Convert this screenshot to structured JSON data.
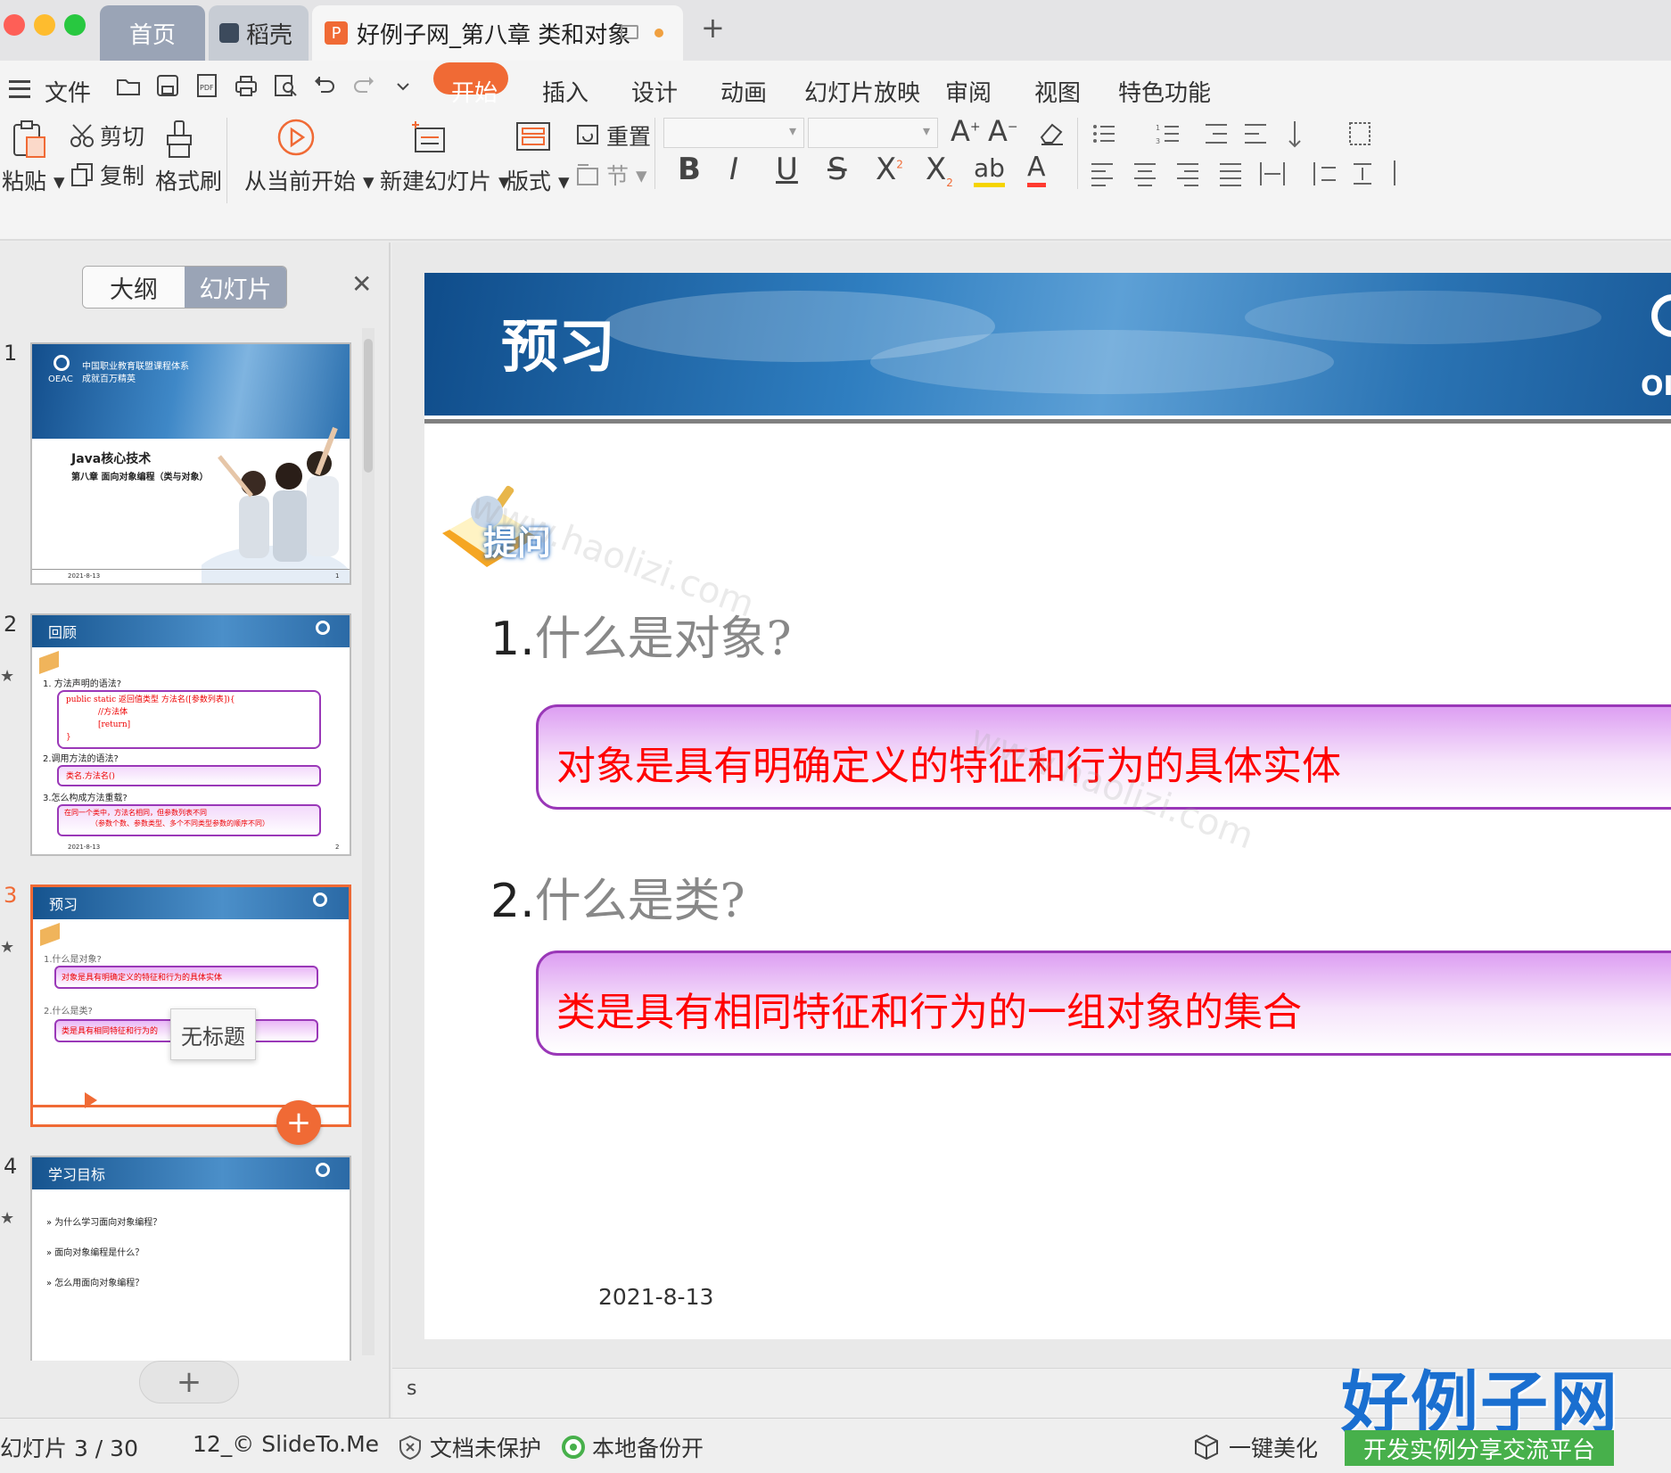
{
  "tabs": {
    "home": "首页",
    "daoke": "稻壳",
    "document": "好例子网_第八章 类和对象"
  },
  "menubar": {
    "file": "文件",
    "items": [
      "开始",
      "插入",
      "设计",
      "动画",
      "幻灯片放映",
      "审阅",
      "视图",
      "特色功能"
    ]
  },
  "toolbar": {
    "paste": "粘贴",
    "cut": "剪切",
    "copy": "复制",
    "format_painter": "格式刷",
    "play_from_current": "从当前开始",
    "new_slide": "新建幻灯片",
    "layout": "版式",
    "reset": "重置",
    "section": "节"
  },
  "sidebar": {
    "outline_tab": "大纲",
    "slides_tab": "幻灯片",
    "tooltip": "无标题",
    "thumbs": [
      {
        "num": "1",
        "title_line1": "中国职业教育联盟课程体系",
        "title_line2": "成就百万精英",
        "course": "Java核心技术",
        "chapter": "第八章 面向对象编程（类与对象）",
        "date": "2021-8-13",
        "logo": "OEAC",
        "page": "1"
      },
      {
        "num": "2",
        "title": "回顾",
        "q1": "方法声明的语法?",
        "code1": "public static 返回值类型 方法名([参数列表]){",
        "code2": "//方法体",
        "code3": "[return]",
        "code4": "}",
        "q2": "2.调用方法的语法?",
        "a2": "类名.方法名()",
        "q3": "3.怎么构成方法重载?",
        "a3_1": "在同一个类中，方法名相同，但参数列表不同",
        "a3_2": "（参数个数、参数类型、多个不同类型参数的顺序不同）",
        "date": "2021-8-13",
        "page": "2"
      },
      {
        "num": "3",
        "title": "预习",
        "q1": "1.什么是对象?",
        "a1": "对象是具有明确定义的特征和行为的具体实体",
        "q2": "2.什么是类?",
        "a2": "类是具有相同特征和行为的"
      },
      {
        "num": "4",
        "title": "学习目标",
        "items": [
          "为什么学习面向对象编程？",
          "面向对象编程是什么？",
          "怎么用面向对象编程？"
        ]
      }
    ]
  },
  "slide": {
    "title": "预习",
    "logo_partial": "OI",
    "badge": "提问",
    "q1_num": "1.",
    "q1_text": "什么是对象?",
    "a1": "对象是具有明确定义的特征和行为的具体实体",
    "q2_num": "2.",
    "q2_text": "什么是类?",
    "a2": "类是具有相同特征和行为的一组对象的集合",
    "date": "2021-8-13"
  },
  "notes": "s",
  "statusbar": {
    "slide_pos": "幻灯片 3 / 30",
    "theme": "12_© SlideTo.Me",
    "protect": "文档未保护",
    "backup": "本地备份开",
    "beautify": "一键美化"
  },
  "watermark": {
    "brand": "好例子网",
    "tagline": "开发实例分享交流平台",
    "url_text": "www.haolizi.com"
  },
  "colors": {
    "accent_orange": "#f06a35",
    "answer_red": "#ff0000",
    "answer_border": "#9a38b8",
    "brand_blue": "#1a6fd0",
    "brand_green": "#47b04b"
  }
}
